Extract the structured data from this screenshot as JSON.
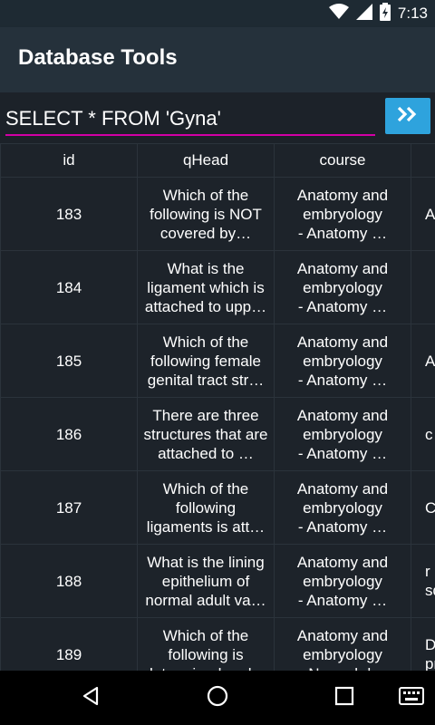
{
  "status": {
    "time": "7:13"
  },
  "app": {
    "title": "Database Tools"
  },
  "query": {
    "value": "SELECT * FROM 'Gyna'"
  },
  "table": {
    "headers": [
      "id",
      "qHead",
      "course",
      ""
    ],
    "rows": [
      {
        "id": "183",
        "qHead": "Which of the following is NOT covered by…",
        "course": "Anatomy and embryology\n - Anatomy …",
        "extra": "Ar"
      },
      {
        "id": "184",
        "qHead": "What is the ligament which is attached to upp…",
        "course": "Anatomy and embryology\n - Anatomy …",
        "extra": ""
      },
      {
        "id": "185",
        "qHead": "Which of the following female genital tract str…",
        "course": "Anatomy and embryology\n - Anatomy …",
        "extra": "Ar"
      },
      {
        "id": "186",
        "qHead": "There are three structures that are attached to …",
        "course": "Anatomy and embryology\n - Anatomy …",
        "extra": "c"
      },
      {
        "id": "187",
        "qHead": "Which of the following ligaments is att…",
        "course": "Anatomy and embryology\n - Anatomy …",
        "extra": "Ca"
      },
      {
        "id": "188",
        "qHead": "What is the lining epithelium of normal adult va…",
        "course": "Anatomy and embryology\n - Anatomy …",
        "extra": "r\nsq"
      },
      {
        "id": "189",
        "qHead": "Which of the following is determined and…",
        "course": "Anatomy and embryology\n - Normal d…",
        "extra": "De\npr"
      }
    ]
  },
  "icons": [
    "wifi-icon",
    "signal-icon",
    "battery-charging-icon",
    "fast-forward-icon",
    "back-icon",
    "home-icon",
    "recents-icon",
    "keyboard-icon"
  ],
  "colors": {
    "accent": "#2ea3dd",
    "underline": "#d200a5",
    "appbar": "#25313b"
  }
}
